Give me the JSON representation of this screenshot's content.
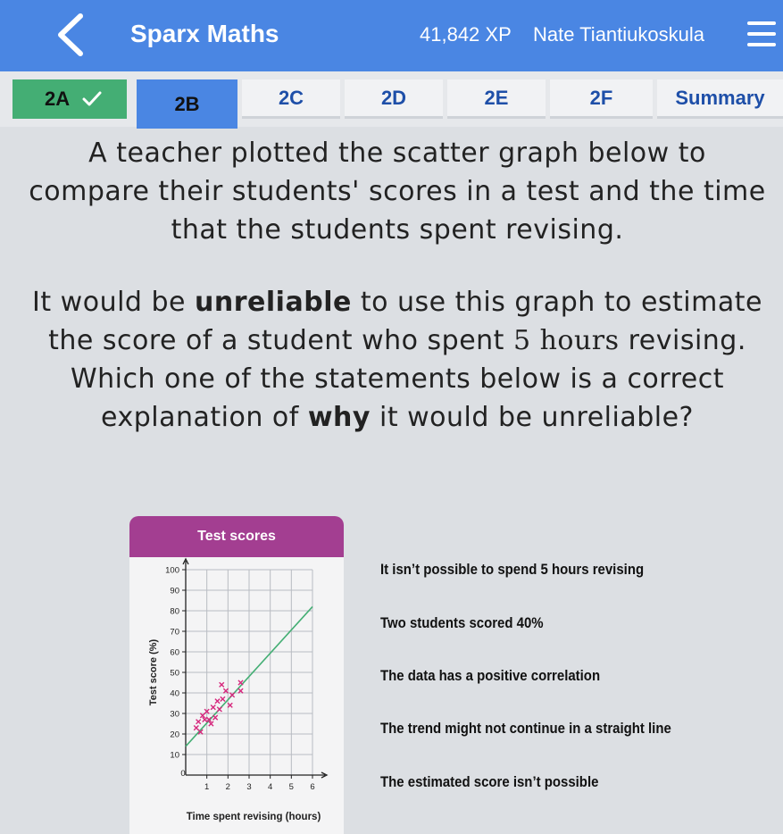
{
  "header": {
    "app_title": "Sparx Maths",
    "xp": "41,842 XP",
    "user_name": "Nate Tiantiukoskula",
    "back_icon": "chevron-left-icon",
    "menu_icon": "hamburger-menu-icon"
  },
  "tabs": [
    {
      "label": "2A",
      "state": "completed"
    },
    {
      "label": "2B",
      "state": "active"
    },
    {
      "label": "2C",
      "state": "pending"
    },
    {
      "label": "2D",
      "state": "pending"
    },
    {
      "label": "2E",
      "state": "pending"
    },
    {
      "label": "2F",
      "state": "pending"
    },
    {
      "label": "Summary",
      "state": "pending"
    }
  ],
  "question": {
    "intro": "A teacher plotted the scatter graph below to compare their students' scores in a test and the time that the students spent revising.",
    "p2_a": "It would be ",
    "p2_b": "unreliable",
    "p2_c": " to use this graph to estimate the score of a student who spent ",
    "p2_num": "5 hours",
    "p2_d": " revising. Which one of the statements below is a correct explanation of ",
    "p2_e": "why",
    "p2_f": " it would be unreliable?"
  },
  "chart_data": {
    "type": "scatter",
    "title": "Test scores",
    "xlabel": "Time spent revising (hours)",
    "ylabel": "Test score (%)",
    "xlim": [
      0,
      6
    ],
    "ylim": [
      0,
      100
    ],
    "xticks": [
      "0",
      "1",
      "2",
      "3",
      "4",
      "5",
      "6"
    ],
    "yticks": [
      "10",
      "20",
      "30",
      "40",
      "50",
      "60",
      "70",
      "80",
      "90",
      "100"
    ],
    "grid": true,
    "points": [
      {
        "x": 0.5,
        "y": 23
      },
      {
        "x": 0.6,
        "y": 26
      },
      {
        "x": 0.7,
        "y": 21
      },
      {
        "x": 0.8,
        "y": 29
      },
      {
        "x": 0.9,
        "y": 27
      },
      {
        "x": 1.0,
        "y": 31
      },
      {
        "x": 1.1,
        "y": 27
      },
      {
        "x": 1.2,
        "y": 25
      },
      {
        "x": 1.3,
        "y": 33
      },
      {
        "x": 1.4,
        "y": 28
      },
      {
        "x": 1.5,
        "y": 36
      },
      {
        "x": 1.6,
        "y": 32
      },
      {
        "x": 1.7,
        "y": 44
      },
      {
        "x": 1.75,
        "y": 37
      },
      {
        "x": 1.9,
        "y": 41
      },
      {
        "x": 2.1,
        "y": 34
      },
      {
        "x": 2.2,
        "y": 39
      },
      {
        "x": 2.6,
        "y": 45
      },
      {
        "x": 2.6,
        "y": 41
      }
    ],
    "trend_line": {
      "x": [
        0,
        6
      ],
      "y": [
        14,
        82
      ]
    },
    "colors": {
      "points": "#d6287d",
      "trend": "#44ae74"
    }
  },
  "options": [
    "It isn’t possible to spend 5 hours revising",
    "Two students scored 40%",
    "The data has a positive correlation",
    "The trend might not continue in a straight line",
    "The estimated score isn’t possible"
  ],
  "colors": {
    "primary": "#4a86e3",
    "completed": "#44ae74",
    "graph_header": "#a33e91"
  }
}
